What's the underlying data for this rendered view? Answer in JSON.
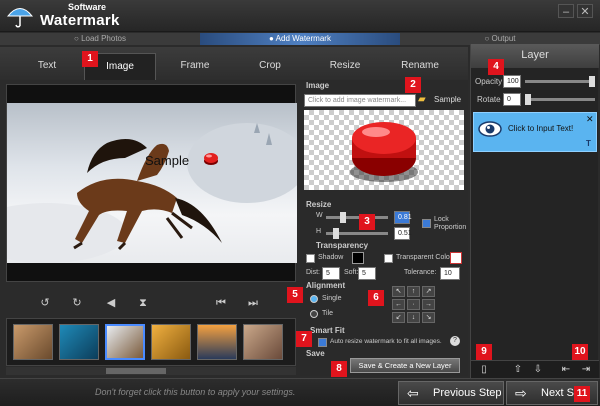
{
  "app": {
    "title_small": "Software",
    "title_main": "Watermark"
  },
  "window_buttons": [
    "–",
    "✕"
  ],
  "steps": [
    "Load Photos",
    "Add Watermark",
    "Output"
  ],
  "tabs": [
    "Text",
    "Image",
    "Frame",
    "Crop",
    "Resize",
    "Rename"
  ],
  "active_tab": "Image",
  "badges": [
    "1",
    "2",
    "3",
    "4",
    "5",
    "6",
    "7",
    "8",
    "9",
    "10",
    "11"
  ],
  "preview": {
    "watermark_text": "Sample"
  },
  "image_section": {
    "title": "Image",
    "placeholder": "Click to add image watermark...",
    "sample_label": "Sample"
  },
  "resize": {
    "title": "Resize",
    "w_label": "W",
    "h_label": "H",
    "w_value": "0.81",
    "h_value": "0.51",
    "lock_label": "Lock Proportion"
  },
  "transparency": {
    "title": "Transparency",
    "shadow_label": "Shadow",
    "transparent_color_label": "Transparent Color",
    "dist_label": "Dist:",
    "dist_value": "5",
    "soft_label": "Soft:",
    "soft_value": "5",
    "tolerance_label": "Tolerance:",
    "tolerance_value": "10"
  },
  "alignment": {
    "title": "Alignment",
    "single_label": "Single",
    "tile_label": "Tile",
    "selected": "Single"
  },
  "smart_fit": {
    "title": "Smart Fit",
    "auto_label": "Auto resize watermark to fit all images.",
    "checked": true
  },
  "save": {
    "title": "Save",
    "button_label": "Save & Create a New Layer"
  },
  "layer": {
    "header": "Layer",
    "opacity_label": "Opacity",
    "opacity_value": "100",
    "rotate_label": "Rotate",
    "rotate_value": "0",
    "item_label": "Click to Input Text!"
  },
  "bottom": {
    "hint": "Don't forget click this button to apply your settings.",
    "previous_label": "Previous Step",
    "next_label": "Next Step"
  },
  "colors": {
    "accent": "#5ab4f0",
    "badge": "#e0141d",
    "step_active": "#4f80c2"
  }
}
